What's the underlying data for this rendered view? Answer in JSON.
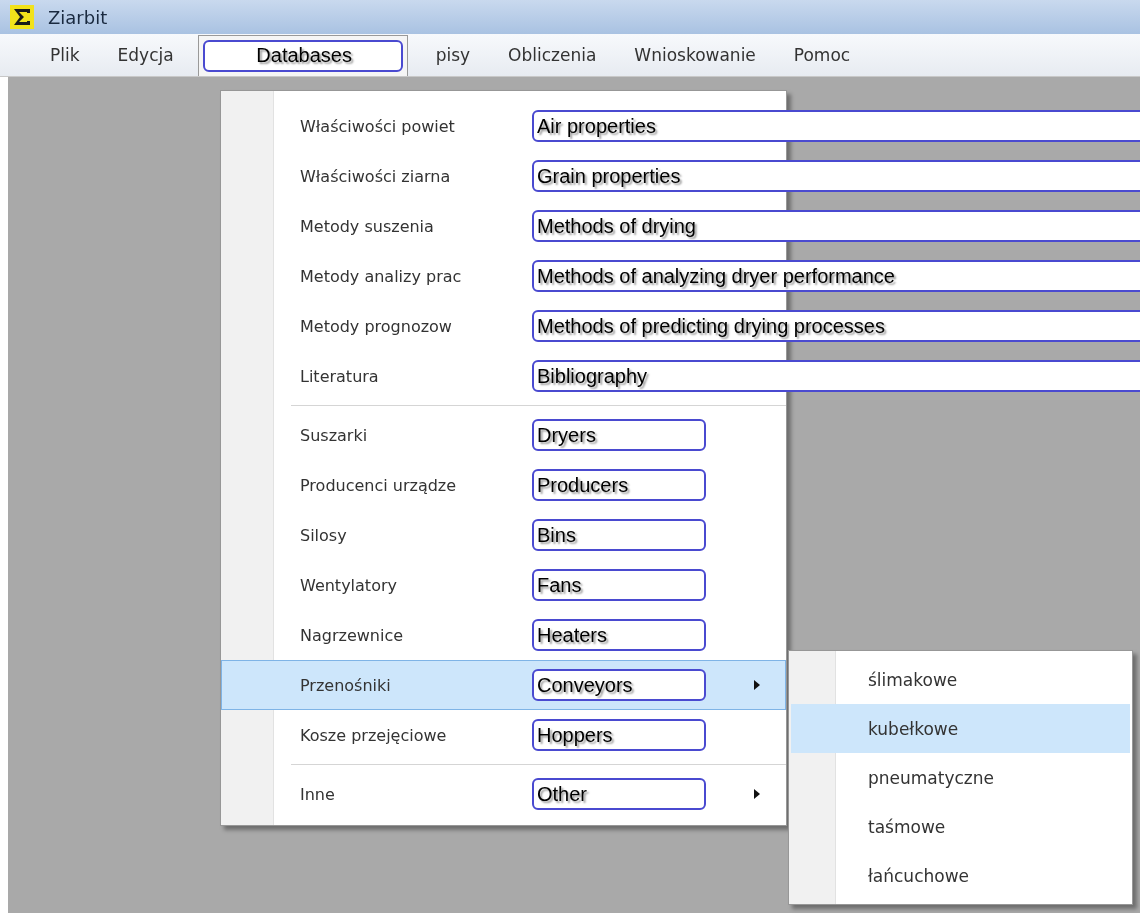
{
  "window": {
    "title": "Ziarbit"
  },
  "menu_bar": [
    {
      "label": "Plik",
      "selected": false,
      "callout": false
    },
    {
      "label": "Edycja",
      "selected": false,
      "callout": false
    },
    {
      "label": "Databases",
      "selected": true,
      "callout": true
    },
    {
      "label": "pisy",
      "selected": false,
      "callout": false
    },
    {
      "label": "Obliczenia",
      "selected": false,
      "callout": false
    },
    {
      "label": "Wnioskowanie",
      "selected": false,
      "callout": false
    },
    {
      "label": "Pomoc",
      "selected": false,
      "callout": false
    }
  ],
  "dropdown": {
    "sections": [
      {
        "kind": "long",
        "items": [
          {
            "label": "Właściwości powiet",
            "callout": "Air properties",
            "selected": false,
            "submenu": false
          },
          {
            "label": "Właściwości ziarna",
            "callout": "Grain properties",
            "selected": false,
            "submenu": false
          },
          {
            "label": "Metody suszenia",
            "callout": "Methods of drying",
            "selected": false,
            "submenu": false
          },
          {
            "label": "Metody analizy prac",
            "callout": "Methods of analyzing dryer performance",
            "selected": false,
            "submenu": false
          },
          {
            "label": "Metody prognozow",
            "callout": "Methods of predicting drying processes",
            "selected": false,
            "submenu": false
          },
          {
            "label": "Literatura",
            "callout": "Bibliography",
            "selected": false,
            "submenu": false
          }
        ]
      },
      {
        "kind": "short",
        "items": [
          {
            "label": "Suszarki",
            "callout": "Dryers",
            "selected": false,
            "submenu": false
          },
          {
            "label": "Producenci urządze",
            "callout": "Producers",
            "selected": false,
            "submenu": false
          },
          {
            "label": "Silosy",
            "callout": "Bins",
            "selected": false,
            "submenu": false
          },
          {
            "label": "Wentylatory",
            "callout": "Fans",
            "selected": false,
            "submenu": false
          },
          {
            "label": "Nagrzewnice",
            "callout": "Heaters",
            "selected": false,
            "submenu": false
          },
          {
            "label": "Przenośniki",
            "callout": "Conveyors",
            "selected": true,
            "submenu": true
          },
          {
            "label": "Kosze przejęciowe",
            "callout": "Hoppers",
            "selected": false,
            "submenu": false
          }
        ]
      },
      {
        "kind": "short",
        "items": [
          {
            "label": "Inne",
            "callout": "Other",
            "selected": false,
            "submenu": true
          }
        ]
      }
    ]
  },
  "submenu": {
    "items": [
      {
        "label": "ślimakowe",
        "selected": false
      },
      {
        "label": "kubełkowe",
        "selected": true
      },
      {
        "label": "pneumatyczne",
        "selected": false
      },
      {
        "label": "taśmowe",
        "selected": false
      },
      {
        "label": "łańcuchowe",
        "selected": false
      }
    ]
  }
}
